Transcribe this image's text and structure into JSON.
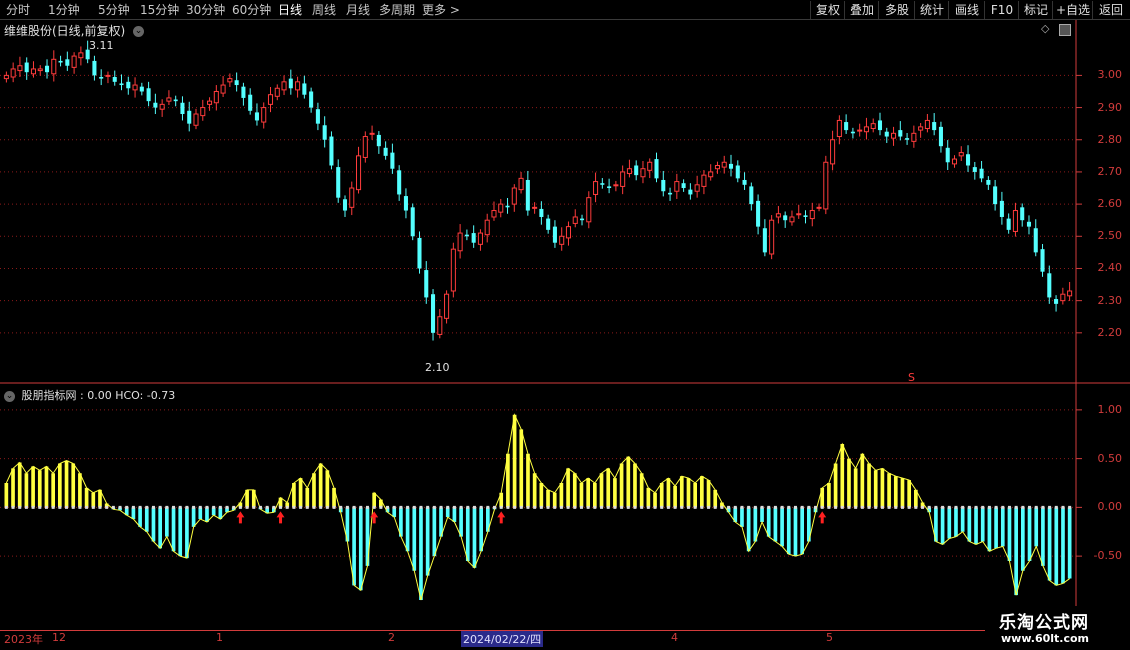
{
  "toolbar": {
    "periods": [
      "分时",
      "1分钟",
      "5分钟",
      "15分钟",
      "30分钟",
      "60分钟",
      "日线",
      "周线",
      "月线",
      "多周期",
      "更多 >"
    ],
    "active_period": "日线",
    "right_buttons": [
      "复权",
      "叠加",
      "多股",
      "统计",
      "画线",
      "F10",
      "标记",
      "+自选",
      "返回"
    ]
  },
  "price_panel": {
    "title": "维维股份(日线,前复权)",
    "high_label": "3.11",
    "low_label": "2.10",
    "marker": "S",
    "y_ticks": [
      "3.00",
      "2.90",
      "2.80",
      "2.70",
      "2.60",
      "2.50",
      "2.40",
      "2.30",
      "2.20"
    ]
  },
  "indicator_panel": {
    "name": "股朋指标网",
    "values_text": ": 0.00  HCO: -0.73",
    "y_ticks": [
      "1.00",
      "0.50",
      "0.00",
      "-0.50"
    ]
  },
  "date_axis": {
    "labels": [
      "2023年",
      "12",
      "1",
      "2",
      "2024/02/22/四",
      "4",
      "5"
    ],
    "highlight": "2024/02/22/四"
  },
  "watermark": {
    "name": "乐淘公式网",
    "url": "www.60lt.com"
  },
  "colors": {
    "up": "#ff3c3c",
    "down": "#54ffff",
    "indicator_pos": "#ffff40",
    "indicator_neg": "#54ffff",
    "grid": "#8b1a1a",
    "axis": "#d23c3c"
  },
  "chart_data": [
    {
      "type": "candlestick",
      "title": "维维股份(日线,前复权)",
      "ylim": [
        2.1,
        3.11
      ],
      "y_ticks": [
        3.0,
        2.9,
        2.8,
        2.7,
        2.6,
        2.5,
        2.4,
        2.3,
        2.2
      ],
      "highest": 3.11,
      "lowest": 2.1,
      "close": [
        3.0,
        3.02,
        3.03,
        3.01,
        3.02,
        3.02,
        3.01,
        3.05,
        3.04,
        3.03,
        3.06,
        3.07,
        3.05,
        3.0,
        2.99,
        3.0,
        2.98,
        2.97,
        2.96,
        2.97,
        2.95,
        2.92,
        2.9,
        2.91,
        2.93,
        2.92,
        2.88,
        2.85,
        2.88,
        2.9,
        2.92,
        2.95,
        2.97,
        2.99,
        2.97,
        2.93,
        2.89,
        2.86,
        2.9,
        2.94,
        2.96,
        2.98,
        2.96,
        2.98,
        2.94,
        2.9,
        2.85,
        2.8,
        2.72,
        2.62,
        2.58,
        2.65,
        2.75,
        2.81,
        2.82,
        2.78,
        2.75,
        2.71,
        2.63,
        2.58,
        2.5,
        2.4,
        2.31,
        2.2,
        2.25,
        2.32,
        2.46,
        2.51,
        2.5,
        2.48,
        2.51,
        2.55,
        2.58,
        2.6,
        2.59,
        2.65,
        2.68,
        2.58,
        2.59,
        2.56,
        2.52,
        2.48,
        2.5,
        2.53,
        2.56,
        2.55,
        2.62,
        2.67,
        2.66,
        2.65,
        2.66,
        2.7,
        2.71,
        2.69,
        2.71,
        2.73,
        2.68,
        2.64,
        2.63,
        2.67,
        2.65,
        2.63,
        2.66,
        2.69,
        2.7,
        2.72,
        2.73,
        2.71,
        2.68,
        2.66,
        2.6,
        2.53,
        2.45,
        2.55,
        2.57,
        2.55,
        2.56,
        2.57,
        2.56,
        2.58,
        2.59,
        2.73,
        2.8,
        2.86,
        2.83,
        2.82,
        2.83,
        2.84,
        2.85,
        2.83,
        2.81,
        2.82,
        2.81,
        2.8,
        2.82,
        2.84,
        2.86,
        2.83,
        2.78,
        2.73,
        2.74,
        2.76,
        2.72,
        2.7,
        2.68,
        2.66,
        2.6,
        2.56,
        2.52,
        2.58,
        2.55,
        2.53,
        2.45,
        2.39,
        2.31,
        2.29,
        2.32,
        2.33
      ]
    },
    {
      "type": "bar",
      "title": "股朋指标网",
      "ylim": [
        -0.95,
        1.05
      ],
      "y_ticks": [
        1.0,
        0.5,
        0.0,
        -0.5
      ],
      "series": [
        {
          "name": "HCO",
          "values": [
            0.25,
            0.4,
            0.46,
            0.35,
            0.42,
            0.38,
            0.42,
            0.35,
            0.45,
            0.48,
            0.45,
            0.35,
            0.2,
            0.15,
            0.18,
            0.04,
            -0.02,
            -0.03,
            -0.08,
            -0.12,
            -0.2,
            -0.25,
            -0.35,
            -0.42,
            -0.3,
            -0.45,
            -0.5,
            -0.52,
            -0.2,
            -0.12,
            -0.15,
            -0.08,
            -0.12,
            -0.05,
            -0.03,
            0.05,
            0.18,
            0.18,
            -0.02,
            -0.06,
            -0.05,
            0.1,
            0.05,
            0.25,
            0.3,
            0.2,
            0.35,
            0.45,
            0.38,
            0.2,
            -0.05,
            -0.35,
            -0.8,
            -0.85,
            -0.6,
            0.15,
            0.08,
            -0.05,
            -0.1,
            -0.3,
            -0.45,
            -0.65,
            -0.95,
            -0.7,
            -0.5,
            -0.3,
            -0.1,
            -0.15,
            -0.3,
            -0.55,
            -0.62,
            -0.45,
            -0.25,
            -0.02,
            0.15,
            0.55,
            0.95,
            0.8,
            0.55,
            0.35,
            0.25,
            0.18,
            0.15,
            0.25,
            0.4,
            0.35,
            0.25,
            0.3,
            0.25,
            0.35,
            0.4,
            0.3,
            0.45,
            0.52,
            0.45,
            0.35,
            0.2,
            0.15,
            0.25,
            0.3,
            0.22,
            0.32,
            0.3,
            0.25,
            0.32,
            0.28,
            0.18,
            0.05,
            -0.05,
            -0.15,
            -0.2,
            -0.45,
            -0.35,
            -0.15,
            -0.3,
            -0.35,
            -0.4,
            -0.48,
            -0.5,
            -0.48,
            -0.35,
            -0.05,
            0.2,
            0.25,
            0.45,
            0.65,
            0.5,
            0.4,
            0.55,
            0.45,
            0.38,
            0.4,
            0.35,
            0.32,
            0.3,
            0.28,
            0.18,
            0.05,
            -0.05,
            -0.35,
            -0.38,
            -0.32,
            -0.3,
            -0.25,
            -0.35,
            -0.38,
            -0.35,
            -0.45,
            -0.42,
            -0.4,
            -0.55,
            -0.9,
            -0.65,
            -0.55,
            -0.4,
            -0.6,
            -0.75,
            -0.8,
            -0.78,
            -0.73
          ]
        }
      ]
    }
  ]
}
